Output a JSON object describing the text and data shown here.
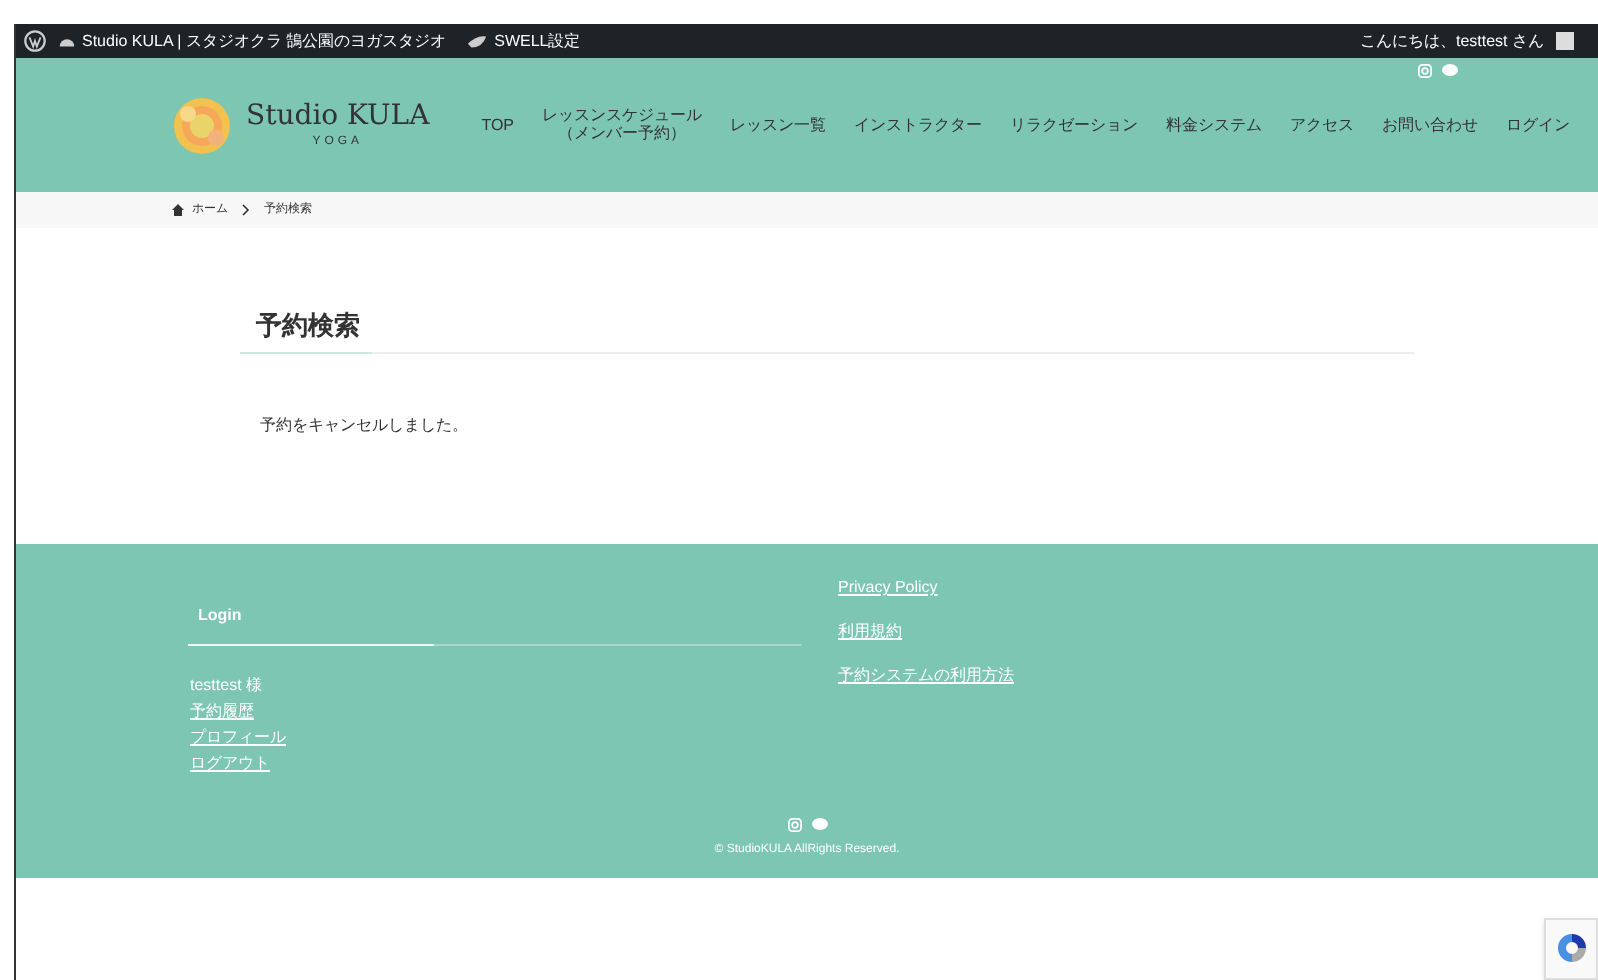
{
  "admin_bar": {
    "site_name": "Studio KULA | スタジオクラ 鵠公園のヨガスタジオ",
    "swell": "SWELL設定",
    "greeting": "こんにちは、testtest さん"
  },
  "header": {
    "logo_text": "Studio KULA",
    "logo_sub": "YOGA",
    "nav": [
      {
        "label": "TOP"
      },
      {
        "lines": [
          "レッスンスケジュール",
          "（メンバー予約）"
        ]
      },
      {
        "label": "レッスン一覧"
      },
      {
        "label": "インストラクター"
      },
      {
        "label": "リラクゼーション"
      },
      {
        "label": "料金システム"
      },
      {
        "label": "アクセス"
      },
      {
        "label": "お問い合わせ"
      },
      {
        "label": "ログイン"
      }
    ]
  },
  "breadcrumb": [
    {
      "label": "ホーム"
    },
    {
      "label": "予約検索"
    }
  ],
  "main": {
    "title": "予約検索",
    "message": "予約をキャンセルしました。"
  },
  "footer": {
    "login_title": "Login",
    "user": "testtest 様",
    "login_links": [
      "予約履歴",
      "プロフィール",
      "ログアウト"
    ],
    "links": [
      "Privacy Policy",
      "利用規約",
      "予約システムの利用方法"
    ],
    "copyright": "© StudioKULA AllRights Reserved."
  }
}
